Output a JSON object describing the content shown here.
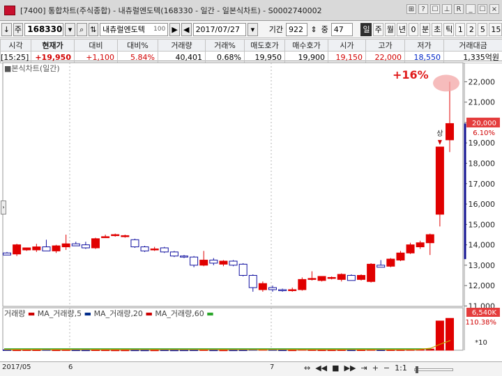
{
  "window": {
    "title": "[7400] 통합차트(주식종합) - 내츄럴엔도텍(168330 - 일간 - 일본식차트) - S0002740002",
    "buttons": [
      "⊞",
      "?",
      "☐",
      "⊥",
      "R",
      "_",
      "☐",
      "×"
    ]
  },
  "toolbar": {
    "arrow_left": "↓",
    "jusik": "주",
    "code": "168330",
    "name": "내츄럴엔도텍",
    "name_suffix": "100",
    "date": "2017/07/27",
    "period_label": "기간",
    "period_value": "922",
    "count_label": "중",
    "count_value": "47",
    "periods": [
      "일",
      "주",
      "월",
      "년",
      "0",
      "분",
      "초",
      "틱",
      "1",
      "2",
      "5",
      "15"
    ],
    "active_period": "일"
  },
  "quote": {
    "headers": [
      "시각",
      "현재가",
      "대비",
      "대비%",
      "거래량",
      "거래%",
      "매도호가",
      "매수호가",
      "시가",
      "고가",
      "저가",
      "거래대금"
    ],
    "values": [
      "[15:25]",
      "+19,950",
      "+1,100",
      "5.84%",
      "40,401",
      "0.68%",
      "19,950",
      "19,900",
      "19,150",
      "22,000",
      "18,550",
      "1,335억원"
    ]
  },
  "chart": {
    "label": "■본식차트(일간)",
    "annotation": "+16%",
    "limit_up_label": "상",
    "current_price_tag": "20,000",
    "current_change_tag": "6.10%",
    "volume_tag": "6,540K",
    "volume_pct_tag": "110.38%",
    "volume_scale": "*10",
    "volume_legend": {
      "title": "거래량",
      "ma5": "MA_거래량,5",
      "ma20": "MA_거래량,20",
      "ma60": "MA_거래량,60"
    },
    "bottom_dates": [
      "2017/05",
      "6",
      "7"
    ],
    "zoom_label": "1:1"
  },
  "chart_data": {
    "type": "candlestick",
    "title": "본식차트(일간)",
    "ylim": [
      11000,
      22800
    ],
    "y_ticks": [
      11000,
      12000,
      13000,
      14000,
      15000,
      16000,
      17000,
      18000,
      19000,
      20000,
      21000,
      22000
    ],
    "colors": {
      "up": "#e00000",
      "down": "#1010a0",
      "grid": "#cfcfcf"
    },
    "candles": [
      {
        "o": 13600,
        "h": 13650,
        "l": 13500,
        "c": 13500
      },
      {
        "o": 13550,
        "h": 14050,
        "l": 13450,
        "c": 14000
      },
      {
        "o": 13750,
        "h": 13850,
        "l": 13700,
        "c": 13850
      },
      {
        "o": 13750,
        "h": 14050,
        "l": 13650,
        "c": 13900
      },
      {
        "o": 13900,
        "h": 14250,
        "l": 13700,
        "c": 13700
      },
      {
        "o": 13700,
        "h": 14000,
        "l": 13600,
        "c": 13950
      },
      {
        "o": 13900,
        "h": 14500,
        "l": 13750,
        "c": 14050
      },
      {
        "o": 14050,
        "h": 14150,
        "l": 13950,
        "c": 13950
      },
      {
        "o": 14000,
        "h": 14150,
        "l": 13800,
        "c": 13850
      },
      {
        "o": 13850,
        "h": 14350,
        "l": 13800,
        "c": 14300
      },
      {
        "o": 14400,
        "h": 14500,
        "l": 14350,
        "c": 14400
      },
      {
        "o": 14450,
        "h": 14550,
        "l": 14400,
        "c": 14500
      },
      {
        "o": 14400,
        "h": 14500,
        "l": 14350,
        "c": 14450
      },
      {
        "o": 14250,
        "h": 14300,
        "l": 13850,
        "c": 13900
      },
      {
        "o": 13900,
        "h": 13950,
        "l": 13650,
        "c": 13700
      },
      {
        "o": 13750,
        "h": 13900,
        "l": 13700,
        "c": 13800
      },
      {
        "o": 13850,
        "h": 13900,
        "l": 13600,
        "c": 13650
      },
      {
        "o": 13650,
        "h": 13700,
        "l": 13400,
        "c": 13450
      },
      {
        "o": 13450,
        "h": 13500,
        "l": 13350,
        "c": 13400
      },
      {
        "o": 13400,
        "h": 13450,
        "l": 12900,
        "c": 13000
      },
      {
        "o": 13000,
        "h": 13700,
        "l": 12950,
        "c": 13250
      },
      {
        "o": 13250,
        "h": 13350,
        "l": 13000,
        "c": 13100
      },
      {
        "o": 13050,
        "h": 13250,
        "l": 12950,
        "c": 13200
      },
      {
        "o": 13200,
        "h": 13250,
        "l": 12950,
        "c": 13000
      },
      {
        "o": 13050,
        "h": 13100,
        "l": 12450,
        "c": 12500
      },
      {
        "o": 12500,
        "h": 12550,
        "l": 11700,
        "c": 11900
      },
      {
        "o": 11800,
        "h": 12200,
        "l": 11700,
        "c": 12100
      },
      {
        "o": 11900,
        "h": 12000,
        "l": 11700,
        "c": 11800
      },
      {
        "o": 11800,
        "h": 11850,
        "l": 11700,
        "c": 11750
      },
      {
        "o": 11800,
        "h": 11900,
        "l": 11700,
        "c": 11800
      },
      {
        "o": 11800,
        "h": 12400,
        "l": 11750,
        "c": 12300
      },
      {
        "o": 12300,
        "h": 12700,
        "l": 12250,
        "c": 12350
      },
      {
        "o": 12250,
        "h": 12450,
        "l": 12200,
        "c": 12450
      },
      {
        "o": 12350,
        "h": 12450,
        "l": 12300,
        "c": 12400
      },
      {
        "o": 12300,
        "h": 12600,
        "l": 12200,
        "c": 12550
      },
      {
        "o": 12500,
        "h": 12550,
        "l": 12300,
        "c": 12250
      },
      {
        "o": 12300,
        "h": 12550,
        "l": 12250,
        "c": 12500
      },
      {
        "o": 12200,
        "h": 13100,
        "l": 12150,
        "c": 13050
      },
      {
        "o": 13000,
        "h": 13250,
        "l": 12950,
        "c": 12900
      },
      {
        "o": 12950,
        "h": 13350,
        "l": 12900,
        "c": 13300
      },
      {
        "o": 13250,
        "h": 13700,
        "l": 13200,
        "c": 13600
      },
      {
        "o": 13600,
        "h": 14100,
        "l": 13550,
        "c": 14000
      },
      {
        "o": 13900,
        "h": 14200,
        "l": 13800,
        "c": 14100
      },
      {
        "o": 14100,
        "h": 14550,
        "l": 13500,
        "c": 14500
      },
      {
        "o": 15500,
        "h": 18800,
        "l": 14900,
        "c": 18800
      },
      {
        "o": 19150,
        "h": 22000,
        "l": 18550,
        "c": 19950
      }
    ],
    "volume": {
      "ylim": [
        0,
        7000
      ],
      "values": [
        90,
        60,
        80,
        70,
        120,
        60,
        90,
        60,
        50,
        70,
        60,
        40,
        40,
        50,
        40,
        40,
        60,
        40,
        50,
        60,
        90,
        50,
        40,
        50,
        60,
        180,
        160,
        120,
        60,
        50,
        160,
        90,
        60,
        60,
        80,
        60,
        70,
        120,
        70,
        80,
        90,
        120,
        160,
        250,
        6000,
        6540
      ]
    }
  }
}
